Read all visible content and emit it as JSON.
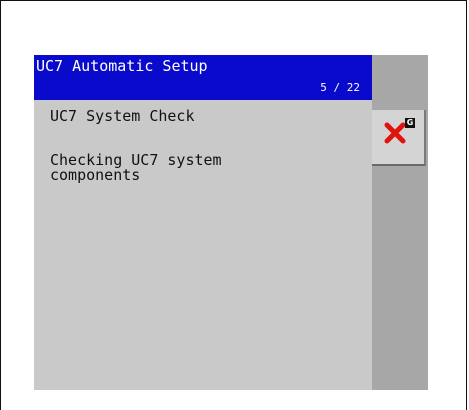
{
  "window": {
    "title": "UC7 Automatic Setup",
    "step_counter": "5 / 22"
  },
  "content": {
    "step_title": "UC7 System Check",
    "step_description": "Checking UC7 system\ncomponents"
  },
  "side_panel": {
    "cancel_button": {
      "icon": "close-icon",
      "badge": "G"
    }
  },
  "colors": {
    "title_bar": "#0a0acd",
    "panel": "#c9c9c9",
    "side_strip": "#a7a7a7",
    "cancel_x": "#e0140c"
  }
}
